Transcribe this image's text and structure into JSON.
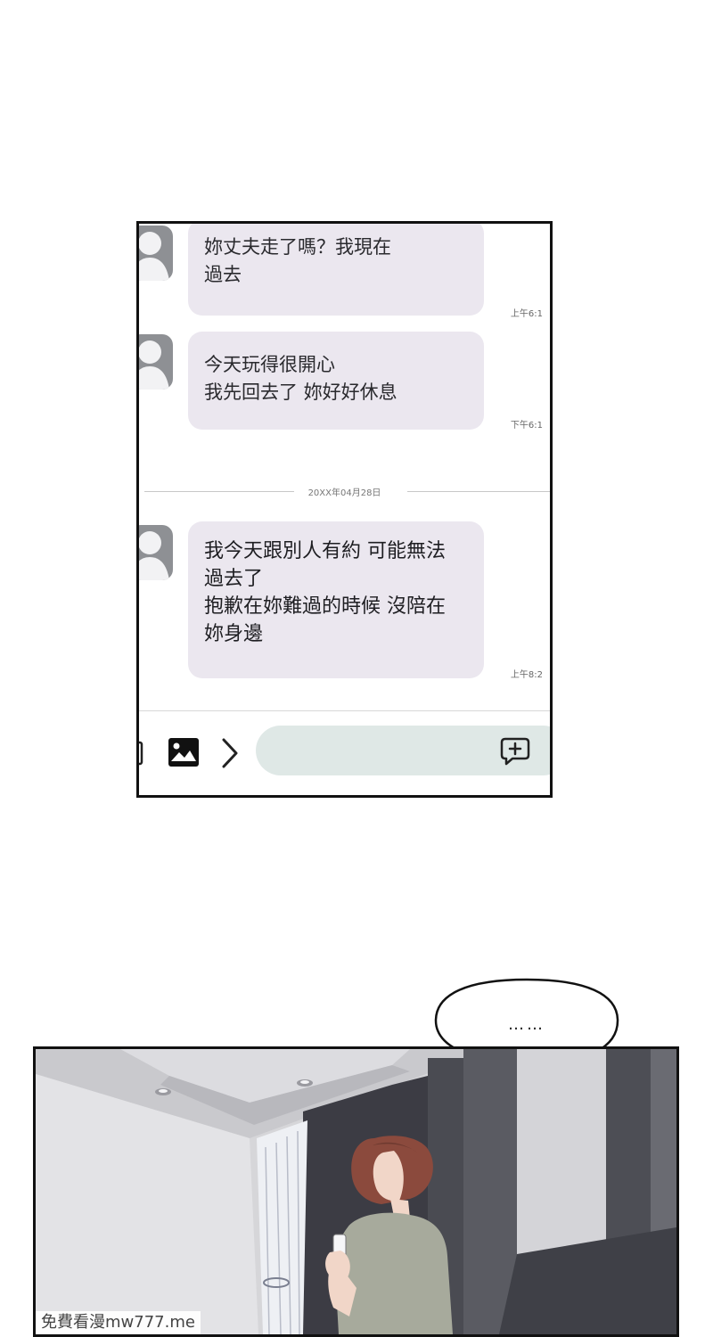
{
  "chat": {
    "messages": [
      {
        "text": "妳丈夫走了嗎？我現在\n過去",
        "time": "上午6:1"
      },
      {
        "text": "今天玩得很開心\n我先回去了 妳好好休息",
        "time": "下午6:1"
      },
      {
        "text": "我今天跟別人有約 可能無法\n過去了\n抱歉在妳難過的時候 沒陪在\n妳身邊",
        "time": "上午8:2"
      }
    ],
    "date_divider": "20XX年04月28日",
    "icons": {
      "attach": "attach-icon",
      "image": "image-icon",
      "expand": "chevron-right-icon",
      "add": "add-comment-icon"
    },
    "input_placeholder": ""
  },
  "speech_bubble": {
    "text": "……"
  },
  "watermark": "免費看漫mw777.me",
  "colors": {
    "bubble": "#ebe7ef",
    "input": "#dfe8e6",
    "avatar": "#8e9094",
    "border": "#111111"
  }
}
